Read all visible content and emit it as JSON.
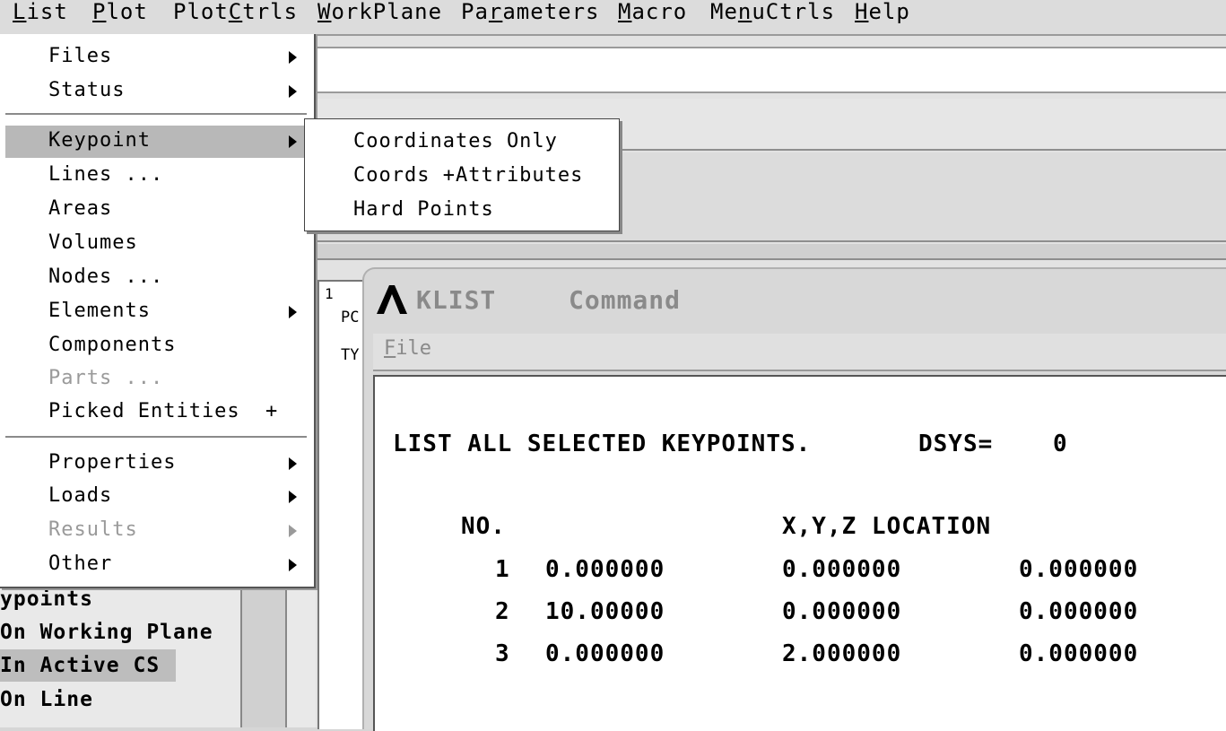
{
  "menubar": {
    "items": [
      {
        "pre": "",
        "u": "L",
        "post": "ist"
      },
      {
        "pre": "",
        "u": "P",
        "post": "lot"
      },
      {
        "pre": "Plot",
        "u": "C",
        "post": "trls"
      },
      {
        "pre": "",
        "u": "W",
        "post": "orkPlane"
      },
      {
        "pre": "Pa",
        "u": "r",
        "post": "ameters"
      },
      {
        "pre": "",
        "u": "M",
        "post": "acro"
      },
      {
        "pre": "Me",
        "u": "n",
        "post": "uCtrls"
      },
      {
        "pre": "",
        "u": "H",
        "post": "elp"
      }
    ]
  },
  "list_menu": {
    "items": [
      {
        "label": "Files",
        "submenu": true
      },
      {
        "label": "Status",
        "submenu": true
      },
      {
        "label": "Keypoint",
        "submenu": true
      },
      {
        "label": "Lines ...",
        "submenu": false
      },
      {
        "label": "Areas",
        "submenu": false
      },
      {
        "label": "Volumes",
        "submenu": false
      },
      {
        "label": "Nodes ...",
        "submenu": false
      },
      {
        "label": "Elements",
        "submenu": true
      },
      {
        "label": "Components",
        "submenu": false
      },
      {
        "label": "Parts ...",
        "submenu": false
      },
      {
        "label": "Picked Entities",
        "plus": "+"
      },
      {
        "label": "Properties",
        "submenu": true
      },
      {
        "label": "Loads",
        "submenu": true
      },
      {
        "label": "Results",
        "submenu": true
      },
      {
        "label": "Other",
        "submenu": true
      }
    ]
  },
  "keypoint_submenu": {
    "items": [
      "Coordinates Only",
      "Coords +Attributes",
      "Hard Points"
    ]
  },
  "tree": {
    "items": [
      "ypoints",
      "On Working Plane",
      "In Active CS",
      "On Line"
    ]
  },
  "output_window": {
    "line_number": "1",
    "row1": "PC",
    "row2": "TY"
  },
  "klist_window": {
    "title": "KLIST",
    "subtitle": "Command",
    "file_menu": {
      "u": "F",
      "post": "ile"
    },
    "header": "LIST ALL SELECTED KEYPOINTS.",
    "dsys_label": "DSYS=",
    "dsys_value": "0",
    "col_no": "NO.",
    "col_location": "X,Y,Z LOCATION",
    "rows": [
      {
        "no": "1",
        "x": "0.000000",
        "y": "0.000000",
        "z": "0.000000"
      },
      {
        "no": "2",
        "x": "10.00000",
        "y": "0.000000",
        "z": "0.000000"
      },
      {
        "no": "3",
        "x": "0.000000",
        "y": "2.000000",
        "z": "0.000000"
      }
    ]
  },
  "colors": {
    "highlight": "#b8b8b8",
    "disabled_text": "#9a9a9a",
    "title_inactive": "#8a8a8a"
  }
}
